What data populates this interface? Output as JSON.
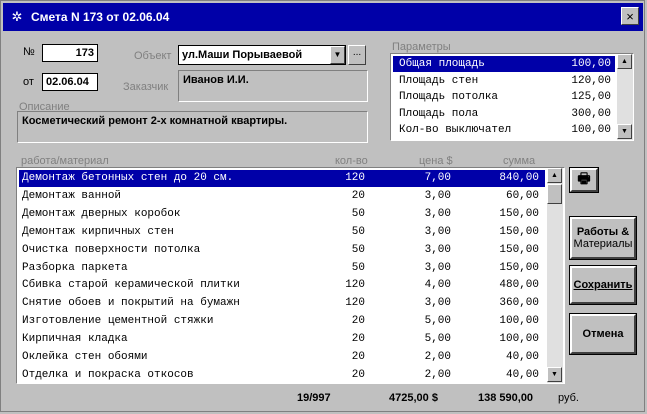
{
  "window": {
    "title": "Смета N 173 от 02.06.04",
    "close": "×"
  },
  "doc": {
    "number_label": "№",
    "number": "173",
    "date_label": "от",
    "date": "02.06.04",
    "object_label": "Объект",
    "object_value": "ул.Маши Порываевой",
    "object_more": "...",
    "customer_label": "Заказчик",
    "customer_value": "Иванов И.И.",
    "description_label": "Описание",
    "description_value": "Косметический ремонт 2-х комнатной квартиры."
  },
  "params": {
    "label": "Параметры",
    "rows": [
      {
        "name": "Общая площадь",
        "value": "100,00",
        "selected": true
      },
      {
        "name": "Площадь стен",
        "value": "120,00"
      },
      {
        "name": "Площадь потолка",
        "value": "125,00"
      },
      {
        "name": "Площадь пола",
        "value": "300,00"
      },
      {
        "name": "Кол-во выключател",
        "value": "100,00"
      }
    ]
  },
  "table": {
    "headers": {
      "work": "работа/материал",
      "qty": "кол-во",
      "price": "цена $",
      "sum": "сумма"
    },
    "rows": [
      {
        "work": "Демонтаж бетонных стен до 20 см.",
        "qty": "120",
        "price": "7,00",
        "sum": "840,00",
        "selected": true
      },
      {
        "work": "Демонтаж ванной",
        "qty": "20",
        "price": "3,00",
        "sum": "60,00"
      },
      {
        "work": "Демонтаж дверных коробок",
        "qty": "50",
        "price": "3,00",
        "sum": "150,00"
      },
      {
        "work": "Демонтаж кирпичных стен",
        "qty": "50",
        "price": "3,00",
        "sum": "150,00"
      },
      {
        "work": "Очистка поверхности потолка",
        "qty": "50",
        "price": "3,00",
        "sum": "150,00"
      },
      {
        "work": "Разборка паркета",
        "qty": "50",
        "price": "3,00",
        "sum": "150,00"
      },
      {
        "work": "Сбивка старой керамической плитки",
        "qty": "120",
        "price": "4,00",
        "sum": "480,00"
      },
      {
        "work": "Снятие обоев и покрытий на бумажн",
        "qty": "120",
        "price": "3,00",
        "sum": "360,00"
      },
      {
        "work": "Изготовление цементной стяжки",
        "qty": "20",
        "price": "5,00",
        "sum": "100,00"
      },
      {
        "work": "Кирпичная кладка",
        "qty": "20",
        "price": "5,00",
        "sum": "100,00"
      },
      {
        "work": "Оклейка стен обоями",
        "qty": "20",
        "price": "2,00",
        "sum": "40,00"
      },
      {
        "work": "Отделка и покраска откосов",
        "qty": "20",
        "price": "2,00",
        "sum": "40,00"
      }
    ]
  },
  "footer": {
    "count": "19/997",
    "total_usd": "4725,00 $",
    "total_rub": "138 590,00",
    "rub_label": "руб."
  },
  "buttons": {
    "works_line1": "Работы &",
    "works_line2": "Материалы",
    "save": "Сохранить",
    "cancel": "Отмена"
  },
  "icons": {
    "app": "gear-icon",
    "print": "printer-icon",
    "dropdown": "chevron-down-icon",
    "scroll_up": "arrow-up-icon",
    "scroll_down": "arrow-down-icon"
  },
  "colors": {
    "selection": "#0000a8",
    "titlebar": "#0000a8",
    "face": "#c0c0c0"
  }
}
